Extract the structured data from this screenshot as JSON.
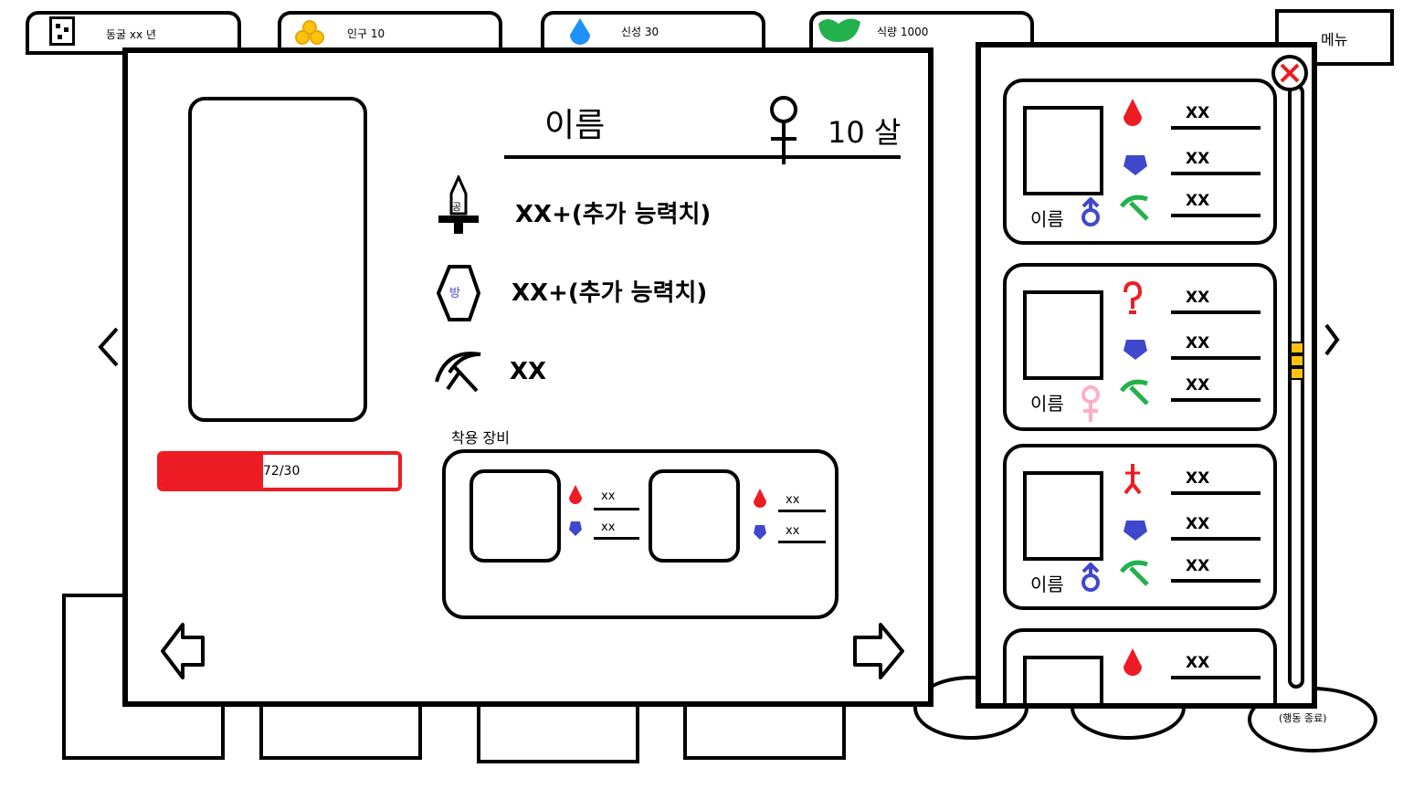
{
  "top_bar": {
    "cave": {
      "label": "동굴 xx 년"
    },
    "population": {
      "label": "인구 10"
    },
    "divinity": {
      "label": "신성   30"
    },
    "food": {
      "label": "식량 1000"
    },
    "menu_label": "메뉴"
  },
  "character": {
    "name": "이름",
    "age": "10 살",
    "gender": "female",
    "hp_text": "72/30",
    "hp_fraction": 0.43,
    "attack_text": "XX+(추가 능력치)",
    "attack_icon_char": "공",
    "defense_text": "XX+(추가 능력치)",
    "defense_icon_char": "방",
    "skill_text": "XX"
  },
  "equipment": {
    "title": "착용 장비",
    "slots": [
      {
        "attack": "xx",
        "defense": "xx"
      },
      {
        "attack": "xx",
        "defense": "xx"
      }
    ]
  },
  "roster": {
    "cards": [
      {
        "name": "이름",
        "gender": "male",
        "weapon": "drop",
        "v1": "XX",
        "v2": "XX",
        "v3": "XX"
      },
      {
        "name": "이름",
        "gender": "female",
        "weapon": "hook",
        "v1": "XX",
        "v2": "XX",
        "v3": "XX"
      },
      {
        "name": "이름",
        "gender": "male",
        "weapon": "dagger",
        "v1": "XX",
        "v2": "XX",
        "v3": "XX"
      },
      {
        "name": "",
        "gender": "",
        "weapon": "drop",
        "v1": "XX",
        "v2": "",
        "v3": ""
      }
    ]
  },
  "bottom": {
    "end_turn_label": "(행동 종료)"
  },
  "colors": {
    "attack": "#ed1c24",
    "defense": "#3f48cc",
    "skill": "#22b14c",
    "food": "#22b14c",
    "divinity": "#1e90ff",
    "population": "#ffc20e",
    "hp": "#ed1c24",
    "scroll_thumb": "#ffc20e",
    "pink": "#ffaec9"
  }
}
